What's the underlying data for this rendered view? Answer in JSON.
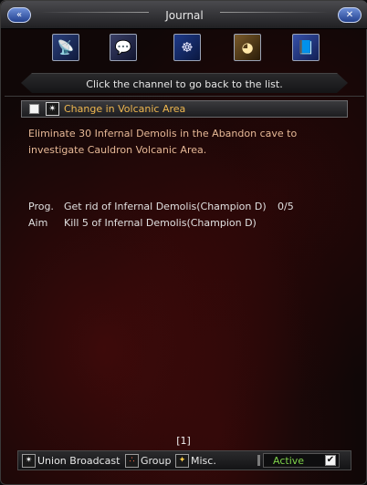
{
  "window": {
    "title": "Journal",
    "left_button_icon": "back-arrows-icon",
    "right_button_icon": "close-x-icon"
  },
  "channels": [
    {
      "name": "satellite-dish-icon",
      "glyph": "📡"
    },
    {
      "name": "chat-person-icon",
      "glyph": "💬"
    },
    {
      "name": "triquetra-emblem-icon",
      "glyph": "☸"
    },
    {
      "name": "golden-orb-icon",
      "glyph": "◕"
    },
    {
      "name": "book-icon",
      "glyph": "📘"
    }
  ],
  "hint": "Click the channel to go back to the list.",
  "quest": {
    "title": "Change in Volcanic Area",
    "type_icon": "burst-icon",
    "checked": false,
    "description": "Eliminate 30 Infernal Demolis in the Abandon cave to investigate Cauldron Volcanic Area.",
    "progress_label": "Prog.",
    "progress_text": "Get rid of Infernal Demolis(Champion D)",
    "progress_count": "0/5",
    "aim_label": "Aim",
    "aim_text": "Kill 5 of Infernal Demolis(Champion D)"
  },
  "page_indicator": "[1]",
  "filters": {
    "union_label": "Union Broadcast",
    "group_label": "Group",
    "misc_label": "Misc.",
    "status_label": "Active",
    "status_checked": true
  },
  "colors": {
    "quest_title": "#f0b850",
    "description": "#e6b896",
    "active": "#7fd24a"
  }
}
